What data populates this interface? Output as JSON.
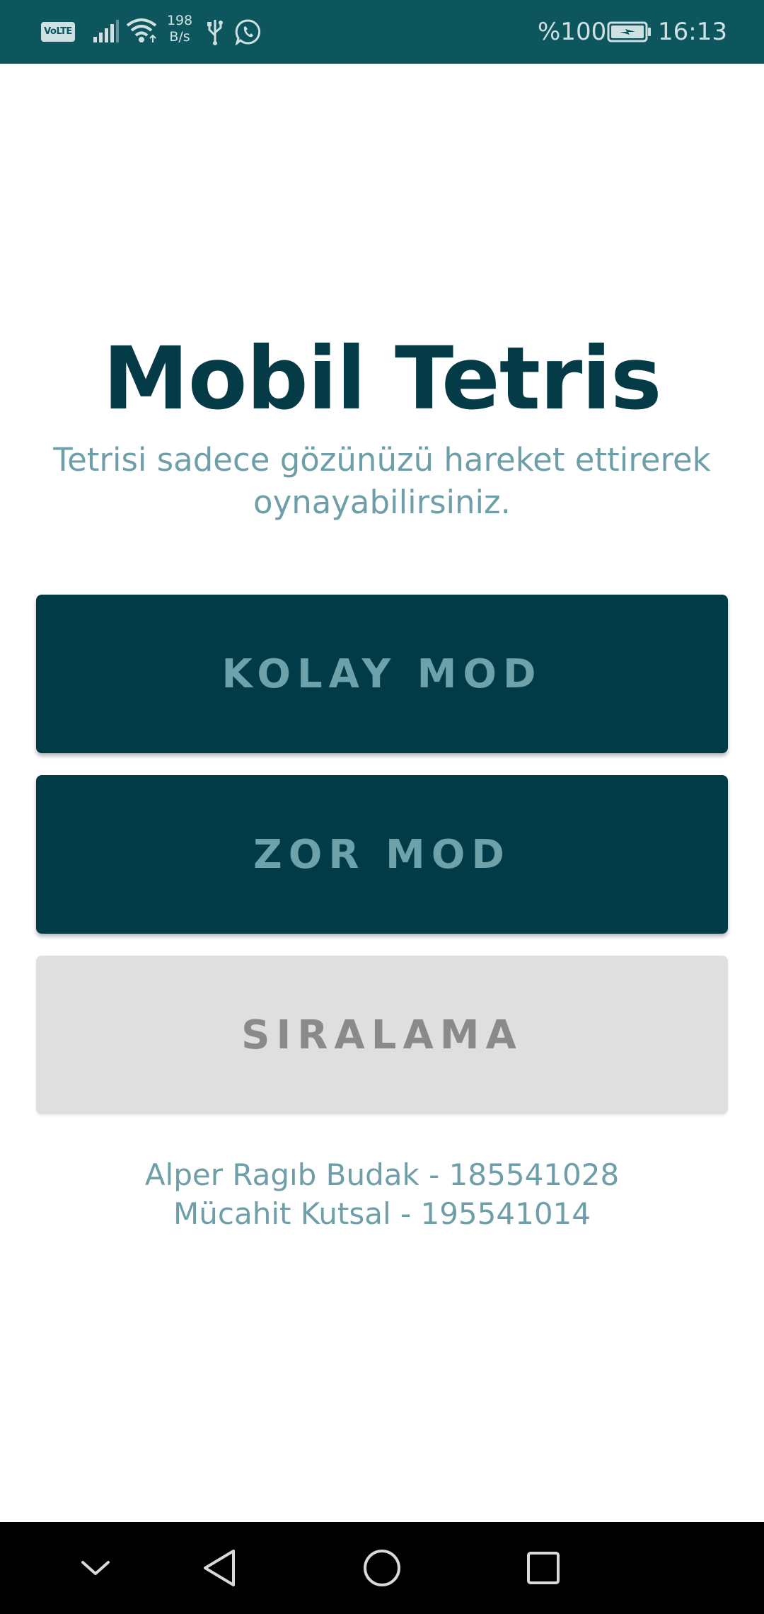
{
  "status_bar": {
    "volte": "VoLTE",
    "net_speed_value": "198",
    "net_speed_unit": "B/s",
    "battery_percent": "%100",
    "time": "16:13",
    "icons": [
      "volte-icon",
      "signal-icon",
      "wifi-icon",
      "usb-icon",
      "whatsapp-icon",
      "battery-charging-icon"
    ]
  },
  "main": {
    "title": "Mobil Tetris",
    "subtitle": "Tetrisi sadece gözünüzü hareket ettirerek oynayabilirsiniz.",
    "buttons": {
      "easy": "KOLAY MOD",
      "hard": "ZOR MOD",
      "ranking": "SIRALAMA"
    },
    "credits": [
      "Alper Ragıb Budak - 185541028",
      "Mücahit Kutsal - 195541014"
    ]
  },
  "nav_bar": {
    "icons": [
      "chevron-down-icon",
      "back-triangle-icon",
      "home-circle-icon",
      "recents-square-icon"
    ]
  },
  "colors": {
    "status_bar": "#0d565e",
    "title": "#053b47",
    "accent_text": "#6e9ea7",
    "primary_button": "#023b48",
    "primary_button_text": "#6da2ab",
    "secondary_button": "#dfdfdf",
    "secondary_button_text": "#8a8a8a",
    "nav_bar": "#000000"
  }
}
